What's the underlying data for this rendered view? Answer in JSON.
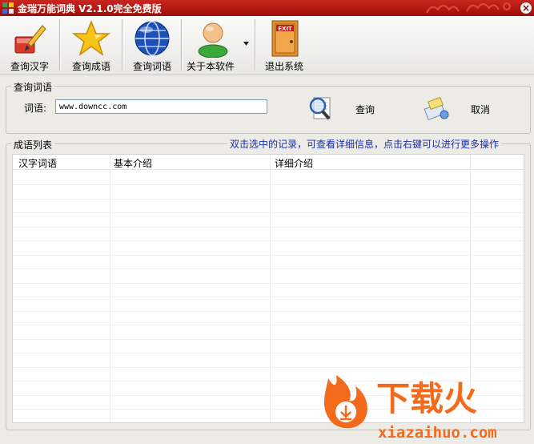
{
  "window": {
    "title": "金瑞万能词典 V2.1.0完全免费版",
    "close_label": "×"
  },
  "toolbar": {
    "buttons": [
      {
        "label": "查询汉字",
        "icon": "brush-icon"
      },
      {
        "label": "查询成语",
        "icon": "star-icon"
      },
      {
        "label": "查询词语",
        "icon": "globe-icon"
      },
      {
        "label": "关于本软件",
        "icon": "user-icon"
      },
      {
        "label": "退出系统",
        "icon": "exit-door-icon"
      }
    ]
  },
  "query": {
    "group_title": "查询词语",
    "field_label": "词语:",
    "field_value": "www.downcc.com",
    "search_label": "查询",
    "cancel_label": "取消"
  },
  "results": {
    "group_title": "成语列表",
    "hint": "双击选中的记录，可查看详细信息，点击右键可以进行更多操作",
    "columns": [
      "汉字词语",
      "基本介绍",
      "详细介绍"
    ],
    "rows": []
  },
  "watermark": {
    "brand": "下载火",
    "domain": "xiazaihuo.com"
  },
  "colors": {
    "titlebar": "#b01a14",
    "hint": "#1a2fa8",
    "brand_orange": "#f26a1b"
  }
}
